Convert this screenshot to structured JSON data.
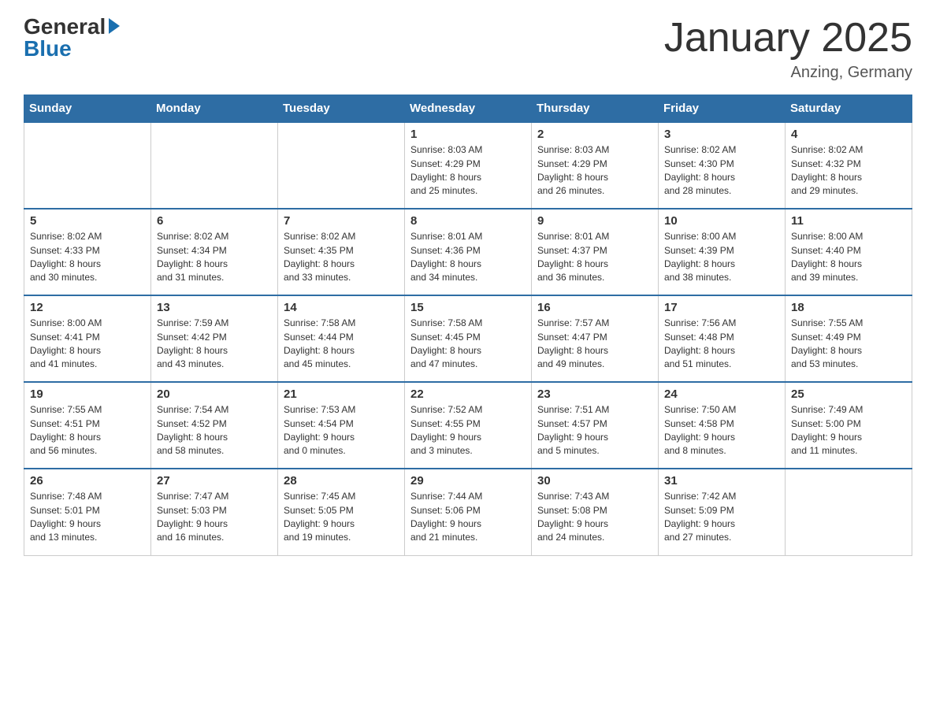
{
  "logo": {
    "general": "General",
    "blue": "Blue"
  },
  "header": {
    "title": "January 2025",
    "subtitle": "Anzing, Germany"
  },
  "weekdays": [
    "Sunday",
    "Monday",
    "Tuesday",
    "Wednesday",
    "Thursday",
    "Friday",
    "Saturday"
  ],
  "weeks": [
    [
      {
        "day": "",
        "info": ""
      },
      {
        "day": "",
        "info": ""
      },
      {
        "day": "",
        "info": ""
      },
      {
        "day": "1",
        "info": "Sunrise: 8:03 AM\nSunset: 4:29 PM\nDaylight: 8 hours\nand 25 minutes."
      },
      {
        "day": "2",
        "info": "Sunrise: 8:03 AM\nSunset: 4:29 PM\nDaylight: 8 hours\nand 26 minutes."
      },
      {
        "day": "3",
        "info": "Sunrise: 8:02 AM\nSunset: 4:30 PM\nDaylight: 8 hours\nand 28 minutes."
      },
      {
        "day": "4",
        "info": "Sunrise: 8:02 AM\nSunset: 4:32 PM\nDaylight: 8 hours\nand 29 minutes."
      }
    ],
    [
      {
        "day": "5",
        "info": "Sunrise: 8:02 AM\nSunset: 4:33 PM\nDaylight: 8 hours\nand 30 minutes."
      },
      {
        "day": "6",
        "info": "Sunrise: 8:02 AM\nSunset: 4:34 PM\nDaylight: 8 hours\nand 31 minutes."
      },
      {
        "day": "7",
        "info": "Sunrise: 8:02 AM\nSunset: 4:35 PM\nDaylight: 8 hours\nand 33 minutes."
      },
      {
        "day": "8",
        "info": "Sunrise: 8:01 AM\nSunset: 4:36 PM\nDaylight: 8 hours\nand 34 minutes."
      },
      {
        "day": "9",
        "info": "Sunrise: 8:01 AM\nSunset: 4:37 PM\nDaylight: 8 hours\nand 36 minutes."
      },
      {
        "day": "10",
        "info": "Sunrise: 8:00 AM\nSunset: 4:39 PM\nDaylight: 8 hours\nand 38 minutes."
      },
      {
        "day": "11",
        "info": "Sunrise: 8:00 AM\nSunset: 4:40 PM\nDaylight: 8 hours\nand 39 minutes."
      }
    ],
    [
      {
        "day": "12",
        "info": "Sunrise: 8:00 AM\nSunset: 4:41 PM\nDaylight: 8 hours\nand 41 minutes."
      },
      {
        "day": "13",
        "info": "Sunrise: 7:59 AM\nSunset: 4:42 PM\nDaylight: 8 hours\nand 43 minutes."
      },
      {
        "day": "14",
        "info": "Sunrise: 7:58 AM\nSunset: 4:44 PM\nDaylight: 8 hours\nand 45 minutes."
      },
      {
        "day": "15",
        "info": "Sunrise: 7:58 AM\nSunset: 4:45 PM\nDaylight: 8 hours\nand 47 minutes."
      },
      {
        "day": "16",
        "info": "Sunrise: 7:57 AM\nSunset: 4:47 PM\nDaylight: 8 hours\nand 49 minutes."
      },
      {
        "day": "17",
        "info": "Sunrise: 7:56 AM\nSunset: 4:48 PM\nDaylight: 8 hours\nand 51 minutes."
      },
      {
        "day": "18",
        "info": "Sunrise: 7:55 AM\nSunset: 4:49 PM\nDaylight: 8 hours\nand 53 minutes."
      }
    ],
    [
      {
        "day": "19",
        "info": "Sunrise: 7:55 AM\nSunset: 4:51 PM\nDaylight: 8 hours\nand 56 minutes."
      },
      {
        "day": "20",
        "info": "Sunrise: 7:54 AM\nSunset: 4:52 PM\nDaylight: 8 hours\nand 58 minutes."
      },
      {
        "day": "21",
        "info": "Sunrise: 7:53 AM\nSunset: 4:54 PM\nDaylight: 9 hours\nand 0 minutes."
      },
      {
        "day": "22",
        "info": "Sunrise: 7:52 AM\nSunset: 4:55 PM\nDaylight: 9 hours\nand 3 minutes."
      },
      {
        "day": "23",
        "info": "Sunrise: 7:51 AM\nSunset: 4:57 PM\nDaylight: 9 hours\nand 5 minutes."
      },
      {
        "day": "24",
        "info": "Sunrise: 7:50 AM\nSunset: 4:58 PM\nDaylight: 9 hours\nand 8 minutes."
      },
      {
        "day": "25",
        "info": "Sunrise: 7:49 AM\nSunset: 5:00 PM\nDaylight: 9 hours\nand 11 minutes."
      }
    ],
    [
      {
        "day": "26",
        "info": "Sunrise: 7:48 AM\nSunset: 5:01 PM\nDaylight: 9 hours\nand 13 minutes."
      },
      {
        "day": "27",
        "info": "Sunrise: 7:47 AM\nSunset: 5:03 PM\nDaylight: 9 hours\nand 16 minutes."
      },
      {
        "day": "28",
        "info": "Sunrise: 7:45 AM\nSunset: 5:05 PM\nDaylight: 9 hours\nand 19 minutes."
      },
      {
        "day": "29",
        "info": "Sunrise: 7:44 AM\nSunset: 5:06 PM\nDaylight: 9 hours\nand 21 minutes."
      },
      {
        "day": "30",
        "info": "Sunrise: 7:43 AM\nSunset: 5:08 PM\nDaylight: 9 hours\nand 24 minutes."
      },
      {
        "day": "31",
        "info": "Sunrise: 7:42 AM\nSunset: 5:09 PM\nDaylight: 9 hours\nand 27 minutes."
      },
      {
        "day": "",
        "info": ""
      }
    ]
  ]
}
